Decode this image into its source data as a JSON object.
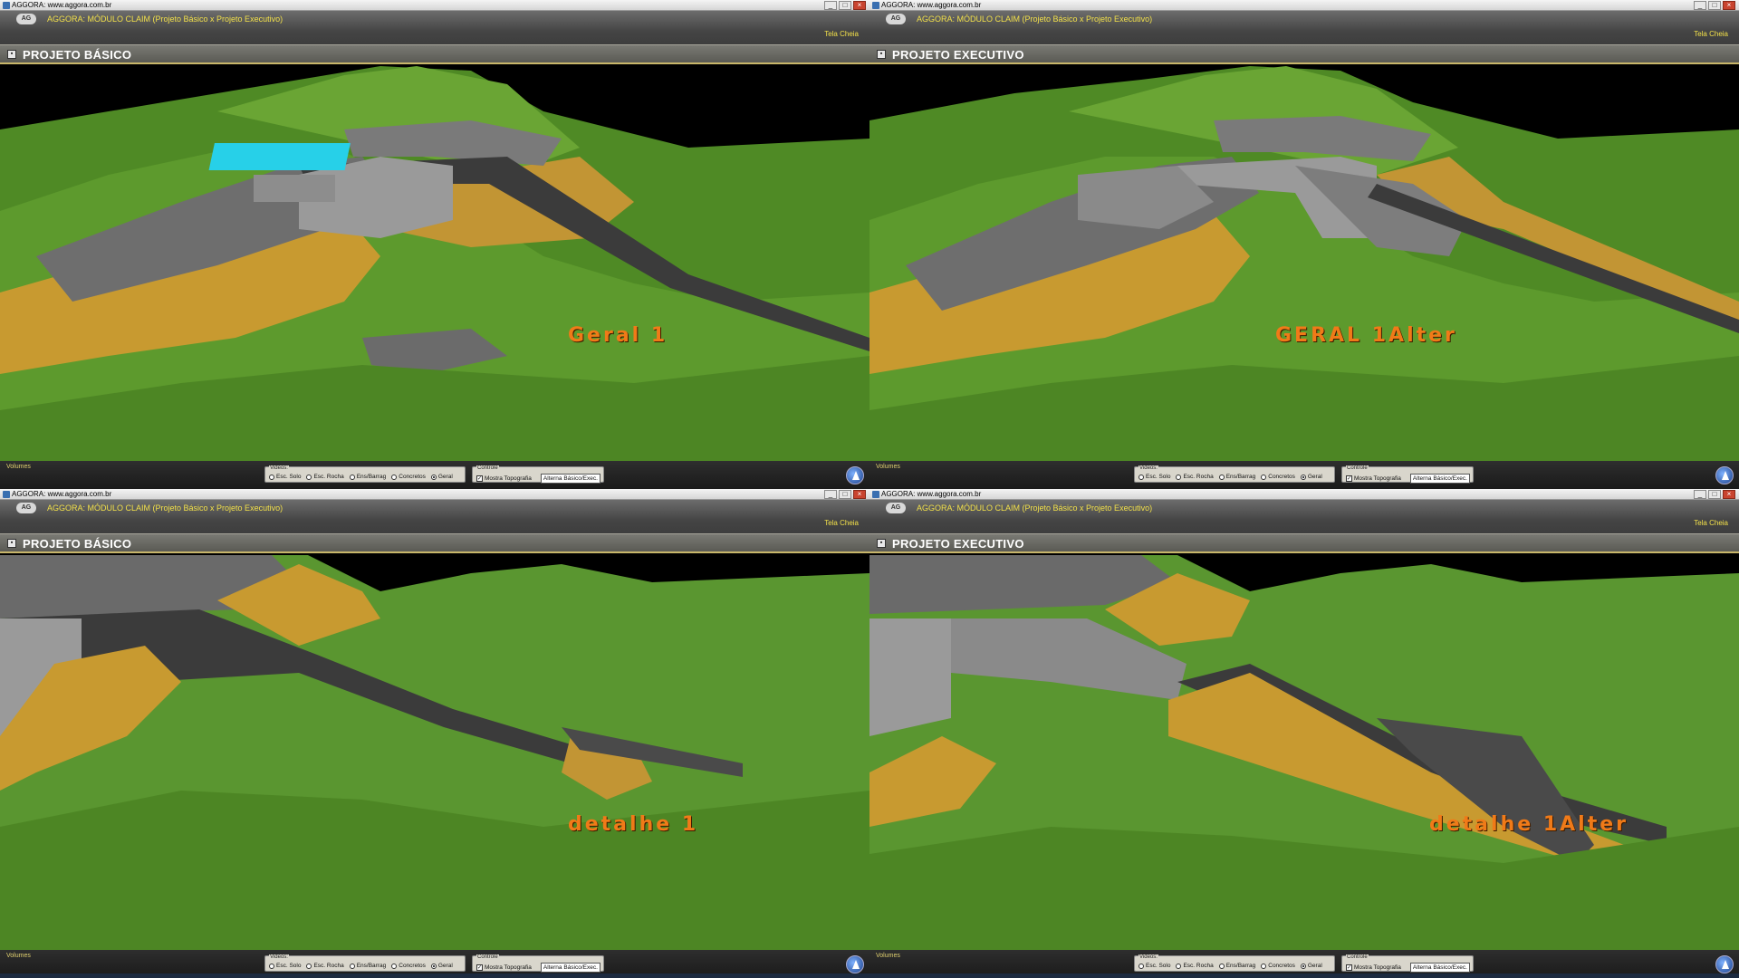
{
  "window": {
    "title": "AGGORA: www.aggora.com.br",
    "controls": [
      "_",
      "□",
      "×"
    ]
  },
  "app": {
    "logo": "AG",
    "title": "AGGORA: MÓDULO CLAIM (Projeto Básico x Projeto Executivo)",
    "fullscreen": "Tela Cheia"
  },
  "controls": {
    "volumes": "Volumes",
    "videos_label": "Videos:",
    "videos_options": [
      "Esc. Solo",
      "Esc. Rocha",
      "Ens/Barrag",
      "Concretos",
      "Geral"
    ],
    "videos_selected": "Geral",
    "controle_label": "Controle",
    "mostra_topografia": "Mostra Topografia",
    "mostra_topografia_checked": true,
    "alterna_button": "Alterna Básico/Exec."
  },
  "panels": [
    {
      "project": "PROJETO BÁSICO",
      "view_label": "Geral 1"
    },
    {
      "project": "PROJETO EXECUTIVO",
      "view_label": "GERAL 1Alter"
    },
    {
      "project": "PROJETO BÁSICO",
      "view_label": "detalhe 1"
    },
    {
      "project": "PROJETO EXECUTIVO",
      "view_label": "detalhe 1Alter"
    }
  ],
  "colors": {
    "terrain": "#5a8f2a",
    "excavation": "#c89a30",
    "concrete": "#8a8a8a",
    "label": "#f07a18",
    "accent_yellow": "#f2e04a"
  }
}
